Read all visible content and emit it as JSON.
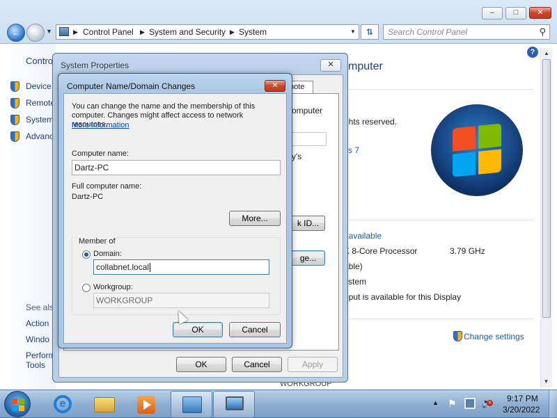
{
  "explorer": {
    "breadcrumb": [
      "Control Panel",
      "System and Security",
      "System"
    ],
    "search_placeholder": "Search Control Panel",
    "sidebar_heading": "Control",
    "sidebar_links": [
      "Device",
      "Remote",
      "System",
      "Advanc"
    ],
    "see_also_heading": "See als",
    "see_also_links": [
      "Action",
      "Windo",
      "Perform",
      "Tools"
    ],
    "heading": "mputer",
    "rights": "ghts reserved.",
    "win7_link": "vs 7",
    "rating_link": "t available",
    "processor": "K 8-Core Processor",
    "processor_speed": "3.79 GHz",
    "ram": "able)",
    "system_type": "ystem",
    "pen_touch": "nput is available for this Display",
    "change_settings": "Change settings",
    "workgroup_cut": "WORKGROUP"
  },
  "sysprops": {
    "title": "System Properties",
    "tab_remote": "note",
    "bg_text1": "omputer",
    "bg_text2": "y's",
    "network_id_button": "k ID...",
    "change_button": "ge...",
    "ok": "OK",
    "cancel": "Cancel",
    "apply": "Apply"
  },
  "dialog": {
    "title": "Computer Name/Domain Changes",
    "intro": "You can change the name and the membership of this computer. Changes might affect access to network resources.",
    "more_info": "More information",
    "computer_name_label": "Computer name:",
    "computer_name_value": "Dartz-PC",
    "full_name_label": "Full computer name:",
    "full_name_value": "Dartz-PC",
    "more_button": "More...",
    "member_of": "Member of",
    "domain_label": "Domain:",
    "domain_value": "collabnet.local",
    "workgroup_label": "Workgroup:",
    "workgroup_value": "WORKGROUP",
    "ok": "OK",
    "cancel": "Cancel"
  },
  "taskbar": {
    "time": "9:17 PM",
    "date": "3/20/2022"
  }
}
